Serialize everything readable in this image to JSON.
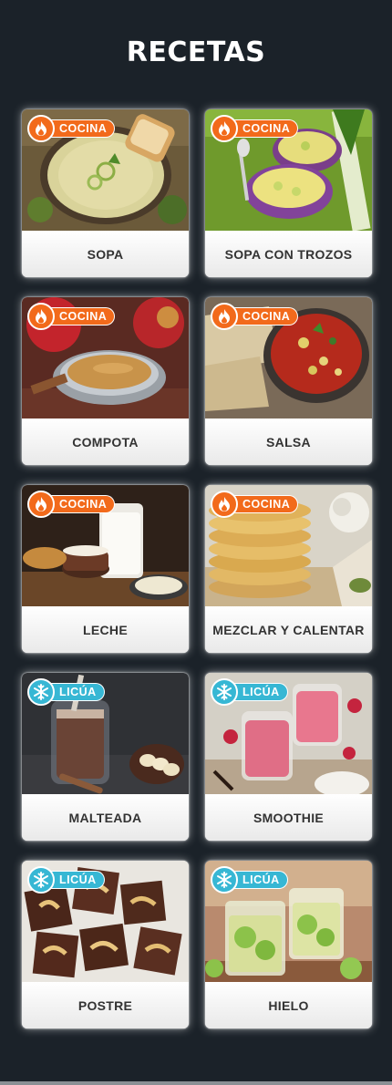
{
  "header": {
    "title": "RECETAS"
  },
  "colors": {
    "background": "#1b2229",
    "cook_badge": "#f26a1b",
    "blend_badge": "#37b7d4"
  },
  "recipes": [
    {
      "label": "SOPA",
      "mode": "cook",
      "mode_label": "COCINA",
      "icon": "flame-icon"
    },
    {
      "label": "SOPA CON TROZOS",
      "mode": "cook",
      "mode_label": "COCINA",
      "icon": "flame-icon"
    },
    {
      "label": "COMPOTA",
      "mode": "cook",
      "mode_label": "COCINA",
      "icon": "flame-icon"
    },
    {
      "label": "SALSA",
      "mode": "cook",
      "mode_label": "COCINA",
      "icon": "flame-icon"
    },
    {
      "label": "LECHE",
      "mode": "cook",
      "mode_label": "COCINA",
      "icon": "flame-icon"
    },
    {
      "label": "MEZCLAR Y CALENTAR",
      "mode": "cook",
      "mode_label": "COCINA",
      "icon": "flame-icon"
    },
    {
      "label": "MALTEADA",
      "mode": "blend",
      "mode_label": "LICÚA",
      "icon": "snowflake-icon"
    },
    {
      "label": "SMOOTHIE",
      "mode": "blend",
      "mode_label": "LICÚA",
      "icon": "snowflake-icon"
    },
    {
      "label": "POSTRE",
      "mode": "blend",
      "mode_label": "LICÚA",
      "icon": "snowflake-icon"
    },
    {
      "label": "HIELO",
      "mode": "blend",
      "mode_label": "LICÚA",
      "icon": "snowflake-icon"
    }
  ]
}
